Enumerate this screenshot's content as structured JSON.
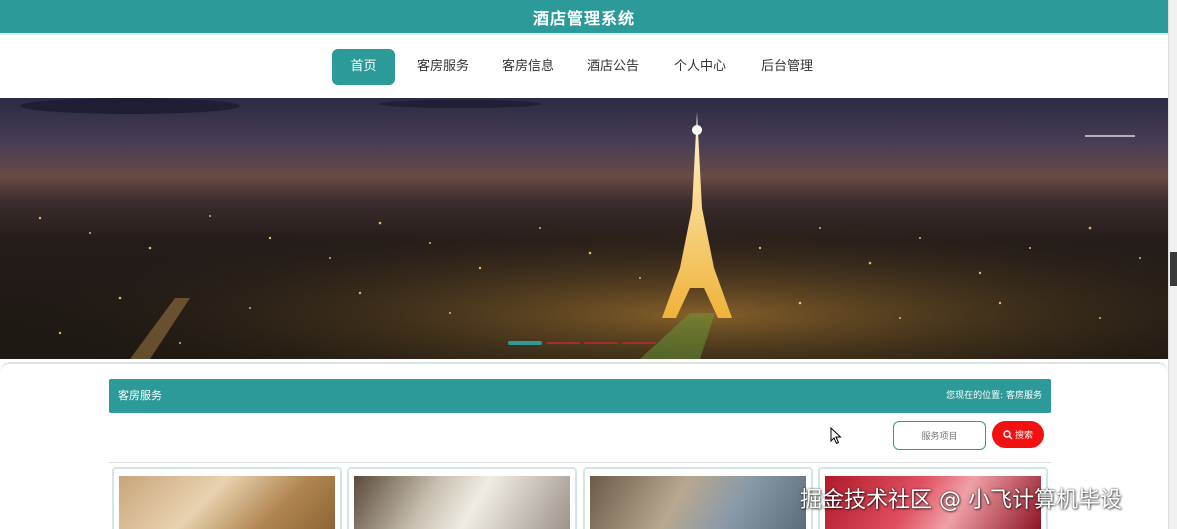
{
  "app": {
    "title": "酒店管理系统"
  },
  "nav": {
    "items": [
      {
        "label": "首页",
        "active": true
      },
      {
        "label": "客房服务",
        "active": false
      },
      {
        "label": "客房信息",
        "active": false
      },
      {
        "label": "酒店公告",
        "active": false
      },
      {
        "label": "个人中心",
        "active": false
      },
      {
        "label": "后台管理",
        "active": false
      }
    ]
  },
  "banner": {
    "image": "paris-eiffel-tower-night",
    "carousel_slides": 3,
    "active_slide": 1
  },
  "section": {
    "title": "客房服务",
    "breadcrumb_prefix": "您现在的位置:",
    "breadcrumb_current": "客房服务",
    "breadcrumb_text": "您现在的位置:  客房服务"
  },
  "search": {
    "placeholder": "服务项目",
    "button_label": "搜索",
    "button_icon": "search-icon"
  },
  "cards": [
    {
      "image": "hotel-room-photo-1"
    },
    {
      "image": "hotel-room-photo-2"
    },
    {
      "image": "hotel-room-photo-3"
    },
    {
      "image": "hotel-room-photo-4"
    }
  ],
  "watermark": "掘金技术社区 @ 小飞计算机毕设",
  "colors": {
    "brand": "#2b9a98",
    "search_button": "#f21111"
  }
}
